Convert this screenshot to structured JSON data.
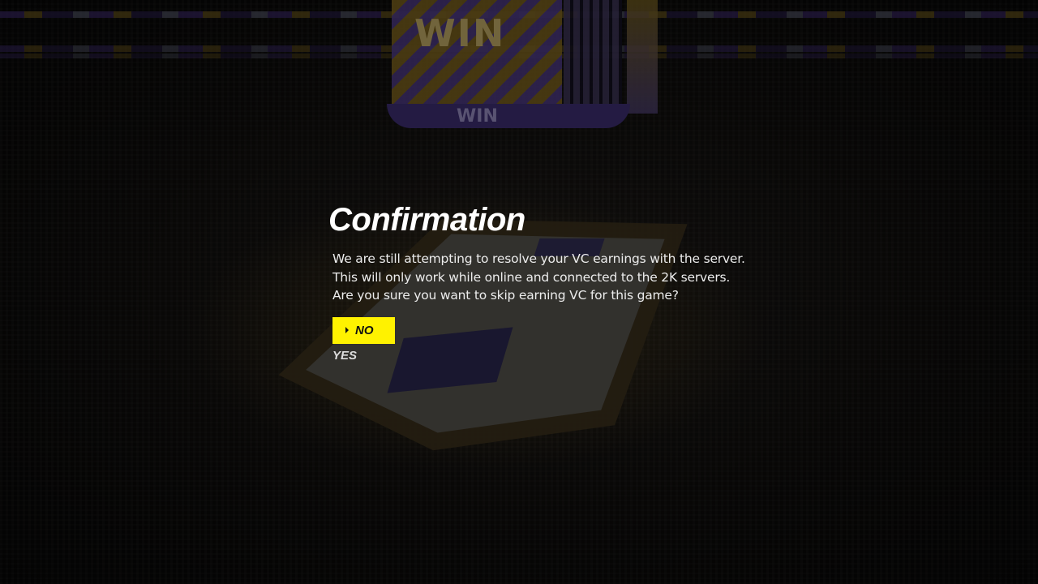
{
  "dialog": {
    "title": "Confirmation",
    "message": "We are still attempting to resolve your VC earnings with the server. This will only work while online and connected to the 2K servers.  Are you sure you want to skip earning VC for this game?",
    "options": [
      {
        "label": "NO",
        "selected": true
      },
      {
        "label": "YES",
        "selected": false
      }
    ]
  },
  "background": {
    "scoreboard_text": "WIN"
  },
  "colors": {
    "highlight": "#fff200",
    "title_text": "#ffffff",
    "body_text": "#ececec"
  },
  "icons": {
    "selection_indicator": "caret-right-icon"
  }
}
